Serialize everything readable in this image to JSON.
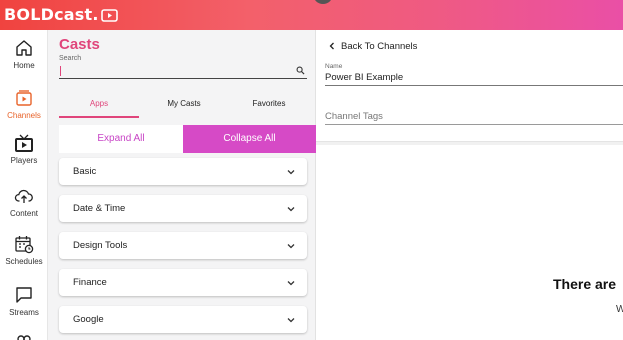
{
  "app": {
    "logo_text": "BOLDcast.",
    "accent": "#e0457b",
    "header_gradient": [
      "#f0433f",
      "#ea4fa6"
    ]
  },
  "nav": {
    "items": [
      {
        "label": "Home",
        "icon": "home-icon"
      },
      {
        "label": "Channels",
        "icon": "channels-icon",
        "active": true
      },
      {
        "label": "Players",
        "icon": "player-tv-icon"
      },
      {
        "label": "Content",
        "icon": "cloud-upload-icon"
      },
      {
        "label": "Schedules",
        "icon": "calendar-clock-icon"
      },
      {
        "label": "Streams",
        "icon": "chat-bubble-icon"
      }
    ]
  },
  "casts": {
    "title": "Casts",
    "search": {
      "label": "Search",
      "value": "",
      "placeholder": ""
    },
    "tabs": [
      {
        "label": "Apps",
        "active": true
      },
      {
        "label": "My Casts"
      },
      {
        "label": "Favorites"
      }
    ],
    "expand_all": "Expand All",
    "collapse_all": "Collapse All",
    "categories": [
      {
        "label": "Basic"
      },
      {
        "label": "Date & Time"
      },
      {
        "label": "Design Tools"
      },
      {
        "label": "Finance"
      },
      {
        "label": "Google"
      }
    ]
  },
  "channel": {
    "back_label": "Back To Channels",
    "name_label": "Name",
    "name_value": "Power BI Example",
    "tags_placeholder": "Channel Tags",
    "empty_heading": "There are",
    "empty_sub": "W"
  }
}
